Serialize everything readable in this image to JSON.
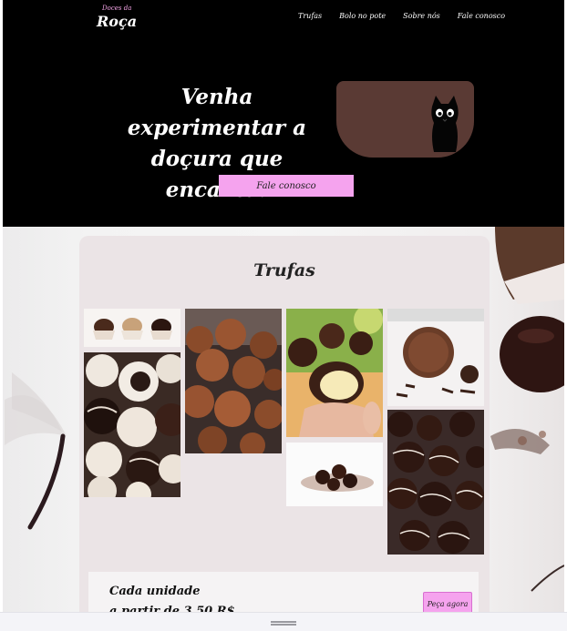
{
  "brand": {
    "small": "Doces da",
    "name": "Roça"
  },
  "nav": {
    "items": [
      {
        "label": "Trufas"
      },
      {
        "label": "Bolo no pote"
      },
      {
        "label": "Sobre nós"
      },
      {
        "label": "Fale conosco"
      }
    ]
  },
  "hero": {
    "headline_line1": "Venha experimentar a",
    "headline_line2": "doçura que encanta!",
    "cta_label": "Fale conosco",
    "card_icon": "black-cat-icon"
  },
  "trufas": {
    "title": "Trufas",
    "photos": [
      {
        "name": "truffle-trio-photo"
      },
      {
        "name": "cocoa-truffles-photo"
      },
      {
        "name": "bitten-truffle-photo"
      },
      {
        "name": "chocolate-curl-truffle-photo"
      },
      {
        "name": "white-chocolate-truffles-photo"
      },
      {
        "name": "cocoa-dust-truffles-photo"
      },
      {
        "name": "striped-truffles-photo"
      }
    ]
  },
  "price": {
    "line1": "Cada unidade",
    "line2": "a partir de 3,50 R$",
    "button_label": "Peça agora"
  },
  "colors": {
    "accent_pink": "#f5a3ee",
    "hero_bg": "#000000",
    "card_brown": "#5a3a34",
    "panel_bg": "#ebe4e6"
  }
}
